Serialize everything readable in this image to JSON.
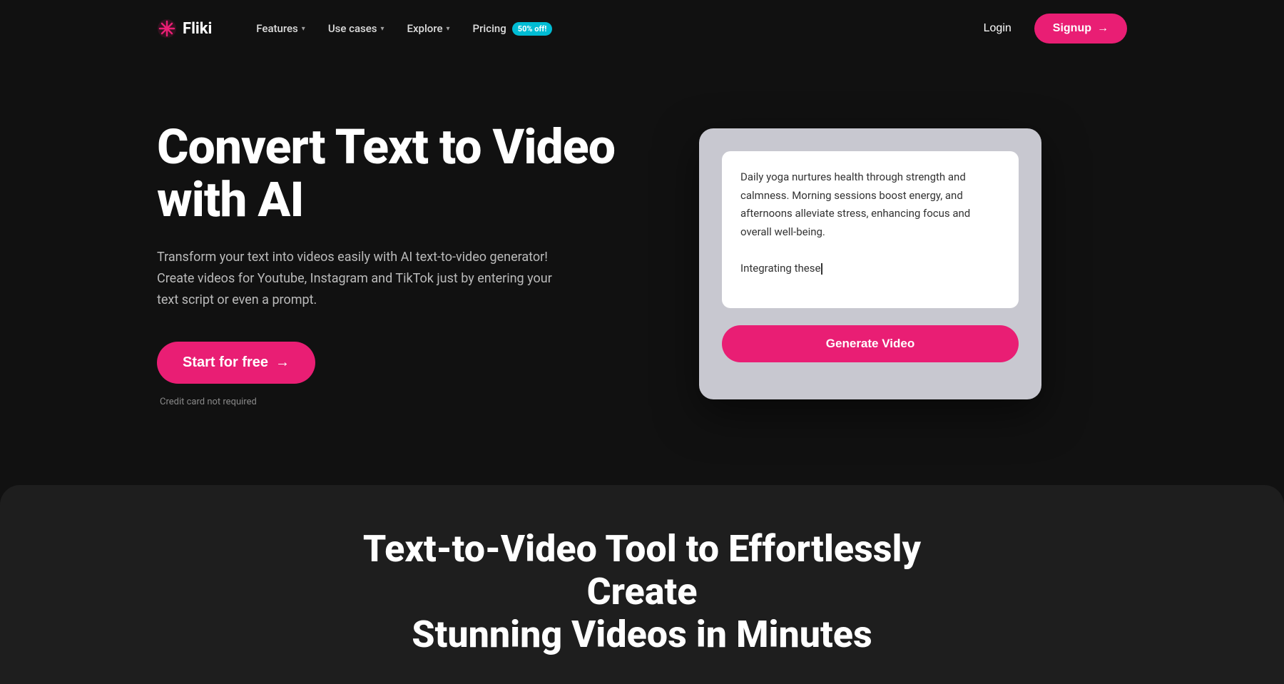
{
  "nav": {
    "logo_text": "Fliki",
    "links": [
      {
        "label": "Features",
        "has_dropdown": true
      },
      {
        "label": "Use cases",
        "has_dropdown": true
      },
      {
        "label": "Explore",
        "has_dropdown": true
      },
      {
        "label": "Pricing",
        "has_dropdown": false
      }
    ],
    "badge_label": "50% off!",
    "login_label": "Login",
    "signup_label": "Signup",
    "signup_arrow": "→"
  },
  "hero": {
    "title_line1": "Convert Text to Video",
    "title_line2": "with AI",
    "subtitle": "Transform your text into videos easily with AI text-to-video generator! Create videos for Youtube, Instagram and TikTok just by entering your text script or even a prompt.",
    "cta_label": "Start for free",
    "cta_arrow": "→",
    "credit_note": "Credit card not required"
  },
  "demo_card": {
    "textarea_text_line1": "Daily yoga nurtures health through strength and calmness. Morning sessions boost energy, and afternoons alleviate stress, enhancing focus and overall well-being.",
    "textarea_text_line2": "Integrating these",
    "generate_label": "Generate Video"
  },
  "bottom": {
    "title_line1": "Text-to-Video Tool to Effortlessly Create",
    "title_line2": "Stunning Videos in Minutes"
  },
  "colors": {
    "accent": "#e91e74",
    "badge_bg": "#00bcd4",
    "bg_dark": "#111111",
    "bg_card": "#c8c8d0",
    "bg_bottom": "#1e1e1e"
  }
}
